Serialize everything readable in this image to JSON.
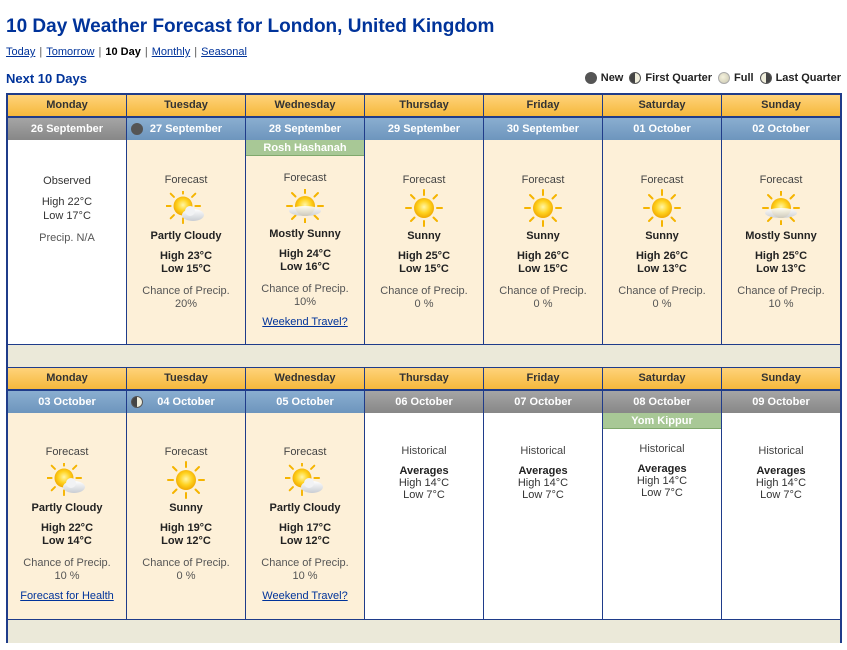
{
  "title": "10 Day Weather Forecast for London, United Kingdom",
  "nav": {
    "today": "Today",
    "tomorrow": "Tomorrow",
    "ten_day": "10 Day",
    "monthly": "Monthly",
    "seasonal": "Seasonal",
    "sep": "|"
  },
  "section_title": "Next 10 Days",
  "legend": {
    "new": "New",
    "first_quarter": "First Quarter",
    "full": "Full",
    "last_quarter": "Last Quarter"
  },
  "week1": {
    "days": [
      "Monday",
      "Tuesday",
      "Wednesday",
      "Thursday",
      "Friday",
      "Saturday",
      "Sunday"
    ],
    "dates": [
      "26 September",
      "27 September",
      "28 September",
      "29 September",
      "30 September",
      "01 October",
      "02 October"
    ],
    "observed": {
      "label": "Observed",
      "high": "High 22°C",
      "low": "Low 17°C",
      "precip": "Precip. N/A"
    },
    "forecasts": [
      {
        "label": "Forecast",
        "icon": "partly-cloudy-icon",
        "condition": "Partly Cloudy",
        "high": "High 23°C",
        "low": "Low 15°C",
        "chance_label": "Chance of Precip.",
        "chance": "20%"
      },
      {
        "label": "Forecast",
        "icon": "mostly-sunny-icon",
        "condition": "Mostly Sunny",
        "high": "High 24°C",
        "low": "Low 16°C",
        "chance_label": "Chance of Precip.",
        "chance": "10%",
        "holiday": "Rosh Hashanah",
        "link": "Weekend Travel?"
      },
      {
        "label": "Forecast",
        "icon": "sunny-icon",
        "condition": "Sunny",
        "high": "High 25°C",
        "low": "Low 15°C",
        "chance_label": "Chance of Precip.",
        "chance": "0 %"
      },
      {
        "label": "Forecast",
        "icon": "sunny-icon",
        "condition": "Sunny",
        "high": "High 26°C",
        "low": "Low 15°C",
        "chance_label": "Chance of Precip.",
        "chance": "0 %"
      },
      {
        "label": "Forecast",
        "icon": "sunny-icon",
        "condition": "Sunny",
        "high": "High 26°C",
        "low": "Low 13°C",
        "chance_label": "Chance of Precip.",
        "chance": "0 %"
      },
      {
        "label": "Forecast",
        "icon": "mostly-sunny-icon",
        "condition": "Mostly Sunny",
        "high": "High 25°C",
        "low": "Low 13°C",
        "chance_label": "Chance of Precip.",
        "chance": "10 %"
      }
    ]
  },
  "week2": {
    "days": [
      "Monday",
      "Tuesday",
      "Wednesday",
      "Thursday",
      "Friday",
      "Saturday",
      "Sunday"
    ],
    "dates": [
      "03 October",
      "04 October",
      "05 October",
      "06 October",
      "07 October",
      "08 October",
      "09 October"
    ],
    "forecasts": [
      {
        "label": "Forecast",
        "icon": "partly-cloudy-icon",
        "condition": "Partly Cloudy",
        "high": "High 22°C",
        "low": "Low 14°C",
        "chance_label": "Chance of Precip.",
        "chance": "10 %",
        "link": "Forecast for Health"
      },
      {
        "label": "Forecast",
        "icon": "sunny-icon",
        "condition": "Sunny",
        "high": "High 19°C",
        "low": "Low 12°C",
        "chance_label": "Chance of Precip.",
        "chance": "0 %"
      },
      {
        "label": "Forecast",
        "icon": "partly-cloudy-icon",
        "condition": "Partly Cloudy",
        "high": "High 17°C",
        "low": "Low 12°C",
        "chance_label": "Chance of Precip.",
        "chance": "10 %",
        "link": "Weekend Travel?"
      }
    ],
    "historical": [
      {
        "label": "Historical",
        "avg": "Averages",
        "high": "High 14°C",
        "low": "Low 7°C"
      },
      {
        "label": "Historical",
        "avg": "Averages",
        "high": "High 14°C",
        "low": "Low 7°C"
      },
      {
        "label": "Historical",
        "avg": "Averages",
        "high": "High 14°C",
        "low": "Low 7°C",
        "holiday": "Yom Kippur"
      },
      {
        "label": "Historical",
        "avg": "Averages",
        "high": "High 14°C",
        "low": "Low 7°C"
      }
    ]
  },
  "colors": {
    "title": "#00339a",
    "border": "#1f3c8a",
    "forecast_bg": "#fdf0d8",
    "date_blue": "#6d95bd",
    "date_gray": "#878787",
    "holiday": "#a8c896"
  }
}
